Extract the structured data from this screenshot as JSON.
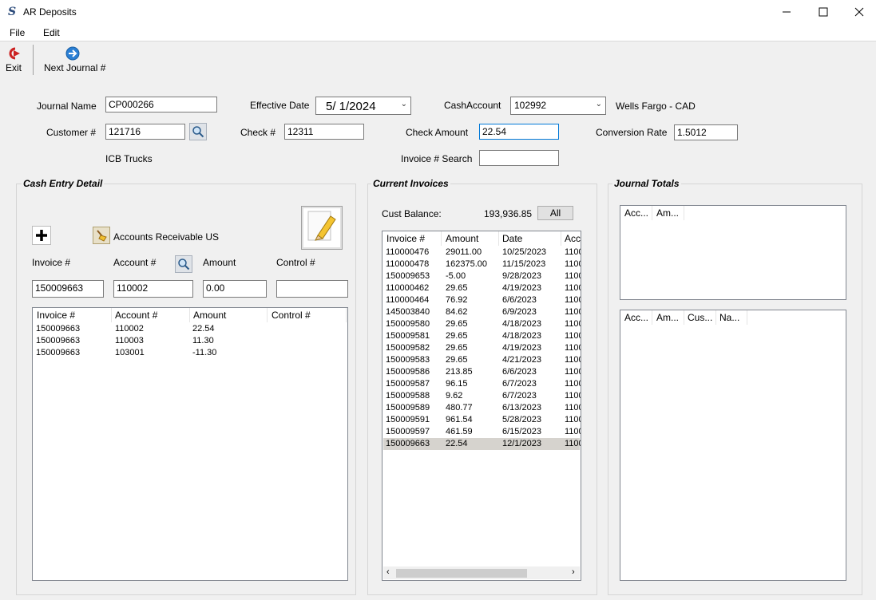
{
  "window": {
    "title": "AR Deposits",
    "app_icon_glyph": "S"
  },
  "menu": {
    "file": "File",
    "edit": "Edit"
  },
  "toolbar": {
    "exit_label": "Exit",
    "next_label": "Next Journal #"
  },
  "header": {
    "journal_name_label": "Journal Name",
    "journal_name_value": "CP000266",
    "effective_date_label": "Effective Date",
    "effective_date_value": "5/  1/2024",
    "cash_account_label": "CashAccount",
    "cash_account_value": "102992",
    "cash_account_name": "Wells Fargo - CAD",
    "customer_label": "Customer #",
    "customer_value": "121716",
    "customer_name": "ICB Trucks",
    "check_label": "Check #",
    "check_value": "12311",
    "check_amount_label": "Check Amount",
    "check_amount_value": "22.54",
    "conversion_rate_label": "Conversion Rate",
    "conversion_rate_value": "1.5012",
    "invoice_search_label": "Invoice # Search",
    "invoice_search_value": ""
  },
  "cash_entry": {
    "title": "Cash Entry Detail",
    "account_caption": "Accounts Receivable US",
    "invoice_label": "Invoice #",
    "account_label": "Account #",
    "amount_label": "Amount",
    "control_label": "Control #",
    "invoice_value": "150009663",
    "account_value": "110002",
    "amount_value": "0.00",
    "control_value": "",
    "columns": [
      "Invoice #",
      "Account #",
      "Amount",
      "Control #"
    ],
    "rows": [
      [
        "150009663",
        "110002",
        "22.54",
        ""
      ],
      [
        "150009663",
        "110003",
        "11.30",
        ""
      ],
      [
        "150009663",
        "103001",
        "-11.30",
        ""
      ]
    ]
  },
  "current_invoices": {
    "title": "Current Invoices",
    "cust_balance_label": "Cust Balance:",
    "cust_balance_value": "193,936.85",
    "all_button": "All",
    "columns": [
      "Invoice #",
      "Amount",
      "Date",
      "Acc"
    ],
    "rows": [
      [
        "110000476",
        "29011.00",
        "10/25/2023",
        "1100"
      ],
      [
        "110000478",
        "162375.00",
        "11/15/2023",
        "1100"
      ],
      [
        "150009653",
        "-5.00",
        "9/28/2023",
        "1100"
      ],
      [
        "110000462",
        "29.65",
        "4/19/2023",
        "1100"
      ],
      [
        "110000464",
        "76.92",
        "6/6/2023",
        "1100"
      ],
      [
        "145003840",
        "84.62",
        "6/9/2023",
        "1100"
      ],
      [
        "150009580",
        "29.65",
        "4/18/2023",
        "1100"
      ],
      [
        "150009581",
        "29.65",
        "4/18/2023",
        "1100"
      ],
      [
        "150009582",
        "29.65",
        "4/19/2023",
        "1100"
      ],
      [
        "150009583",
        "29.65",
        "4/21/2023",
        "1100"
      ],
      [
        "150009586",
        "213.85",
        "6/6/2023",
        "1100"
      ],
      [
        "150009587",
        "96.15",
        "6/7/2023",
        "1100"
      ],
      [
        "150009588",
        "9.62",
        "6/7/2023",
        "1100"
      ],
      [
        "150009589",
        "480.77",
        "6/13/2023",
        "1100"
      ],
      [
        "150009591",
        "961.54",
        "5/28/2023",
        "1100"
      ],
      [
        "150009597",
        "461.59",
        "6/15/2023",
        "1100"
      ],
      [
        "150009663",
        "22.54",
        "12/1/2023",
        "1100"
      ]
    ],
    "selected_row": 16
  },
  "journal_totals": {
    "title": "Journal Totals",
    "top_columns": [
      "Acc...",
      "Am..."
    ],
    "bottom_columns": [
      "Acc...",
      "Am...",
      "Cus...",
      "Na..."
    ]
  },
  "colors": {
    "selection": "#d6d3ce",
    "focus_border": "#0078d7",
    "exit_red": "#cc2222",
    "next_blue": "#2a7fd4"
  }
}
